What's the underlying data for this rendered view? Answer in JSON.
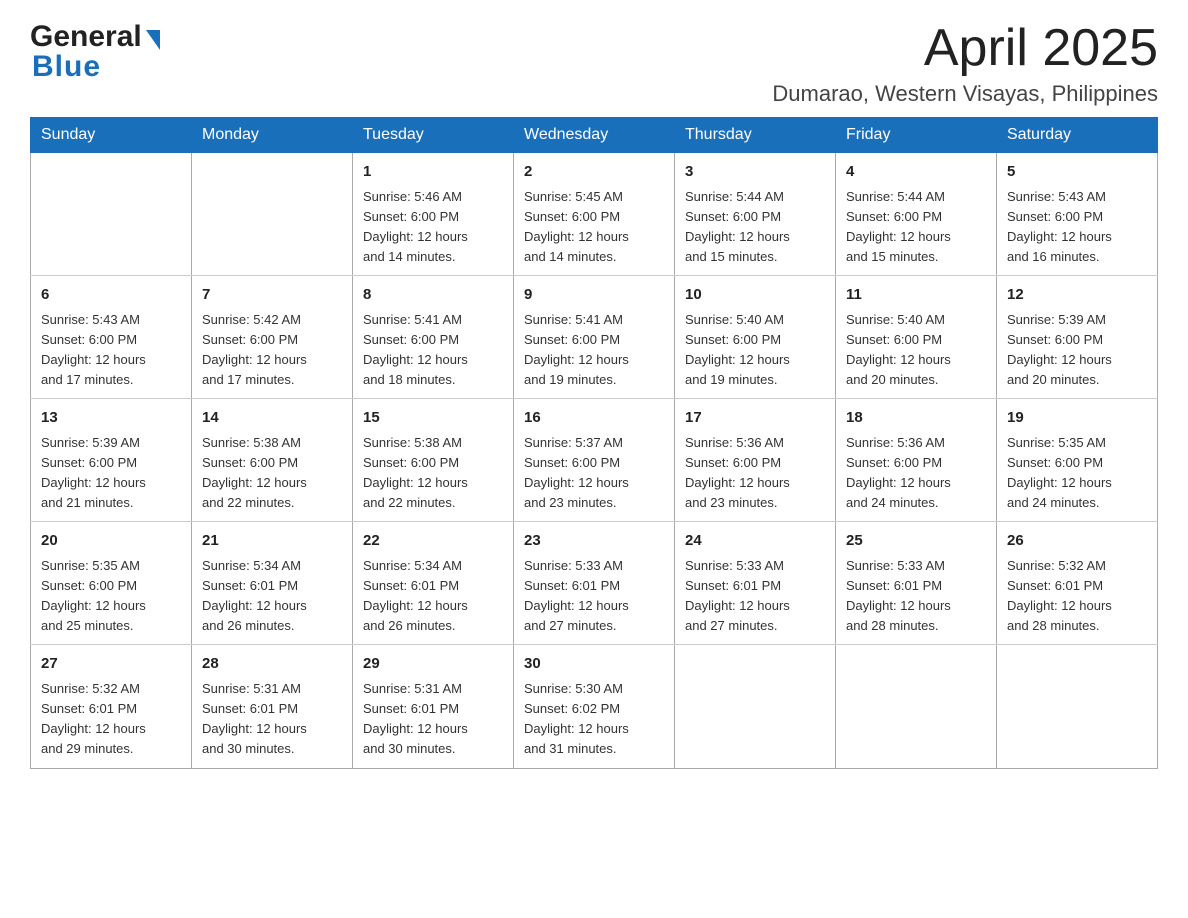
{
  "header": {
    "logo_general": "General",
    "logo_blue": "Blue",
    "month_year": "April 2025",
    "location": "Dumarao, Western Visayas, Philippines"
  },
  "weekdays": [
    "Sunday",
    "Monday",
    "Tuesday",
    "Wednesday",
    "Thursday",
    "Friday",
    "Saturday"
  ],
  "weeks": [
    [
      {
        "day": "",
        "detail": ""
      },
      {
        "day": "",
        "detail": ""
      },
      {
        "day": "1",
        "detail": "Sunrise: 5:46 AM\nSunset: 6:00 PM\nDaylight: 12 hours\nand 14 minutes."
      },
      {
        "day": "2",
        "detail": "Sunrise: 5:45 AM\nSunset: 6:00 PM\nDaylight: 12 hours\nand 14 minutes."
      },
      {
        "day": "3",
        "detail": "Sunrise: 5:44 AM\nSunset: 6:00 PM\nDaylight: 12 hours\nand 15 minutes."
      },
      {
        "day": "4",
        "detail": "Sunrise: 5:44 AM\nSunset: 6:00 PM\nDaylight: 12 hours\nand 15 minutes."
      },
      {
        "day": "5",
        "detail": "Sunrise: 5:43 AM\nSunset: 6:00 PM\nDaylight: 12 hours\nand 16 minutes."
      }
    ],
    [
      {
        "day": "6",
        "detail": "Sunrise: 5:43 AM\nSunset: 6:00 PM\nDaylight: 12 hours\nand 17 minutes."
      },
      {
        "day": "7",
        "detail": "Sunrise: 5:42 AM\nSunset: 6:00 PM\nDaylight: 12 hours\nand 17 minutes."
      },
      {
        "day": "8",
        "detail": "Sunrise: 5:41 AM\nSunset: 6:00 PM\nDaylight: 12 hours\nand 18 minutes."
      },
      {
        "day": "9",
        "detail": "Sunrise: 5:41 AM\nSunset: 6:00 PM\nDaylight: 12 hours\nand 19 minutes."
      },
      {
        "day": "10",
        "detail": "Sunrise: 5:40 AM\nSunset: 6:00 PM\nDaylight: 12 hours\nand 19 minutes."
      },
      {
        "day": "11",
        "detail": "Sunrise: 5:40 AM\nSunset: 6:00 PM\nDaylight: 12 hours\nand 20 minutes."
      },
      {
        "day": "12",
        "detail": "Sunrise: 5:39 AM\nSunset: 6:00 PM\nDaylight: 12 hours\nand 20 minutes."
      }
    ],
    [
      {
        "day": "13",
        "detail": "Sunrise: 5:39 AM\nSunset: 6:00 PM\nDaylight: 12 hours\nand 21 minutes."
      },
      {
        "day": "14",
        "detail": "Sunrise: 5:38 AM\nSunset: 6:00 PM\nDaylight: 12 hours\nand 22 minutes."
      },
      {
        "day": "15",
        "detail": "Sunrise: 5:38 AM\nSunset: 6:00 PM\nDaylight: 12 hours\nand 22 minutes."
      },
      {
        "day": "16",
        "detail": "Sunrise: 5:37 AM\nSunset: 6:00 PM\nDaylight: 12 hours\nand 23 minutes."
      },
      {
        "day": "17",
        "detail": "Sunrise: 5:36 AM\nSunset: 6:00 PM\nDaylight: 12 hours\nand 23 minutes."
      },
      {
        "day": "18",
        "detail": "Sunrise: 5:36 AM\nSunset: 6:00 PM\nDaylight: 12 hours\nand 24 minutes."
      },
      {
        "day": "19",
        "detail": "Sunrise: 5:35 AM\nSunset: 6:00 PM\nDaylight: 12 hours\nand 24 minutes."
      }
    ],
    [
      {
        "day": "20",
        "detail": "Sunrise: 5:35 AM\nSunset: 6:00 PM\nDaylight: 12 hours\nand 25 minutes."
      },
      {
        "day": "21",
        "detail": "Sunrise: 5:34 AM\nSunset: 6:01 PM\nDaylight: 12 hours\nand 26 minutes."
      },
      {
        "day": "22",
        "detail": "Sunrise: 5:34 AM\nSunset: 6:01 PM\nDaylight: 12 hours\nand 26 minutes."
      },
      {
        "day": "23",
        "detail": "Sunrise: 5:33 AM\nSunset: 6:01 PM\nDaylight: 12 hours\nand 27 minutes."
      },
      {
        "day": "24",
        "detail": "Sunrise: 5:33 AM\nSunset: 6:01 PM\nDaylight: 12 hours\nand 27 minutes."
      },
      {
        "day": "25",
        "detail": "Sunrise: 5:33 AM\nSunset: 6:01 PM\nDaylight: 12 hours\nand 28 minutes."
      },
      {
        "day": "26",
        "detail": "Sunrise: 5:32 AM\nSunset: 6:01 PM\nDaylight: 12 hours\nand 28 minutes."
      }
    ],
    [
      {
        "day": "27",
        "detail": "Sunrise: 5:32 AM\nSunset: 6:01 PM\nDaylight: 12 hours\nand 29 minutes."
      },
      {
        "day": "28",
        "detail": "Sunrise: 5:31 AM\nSunset: 6:01 PM\nDaylight: 12 hours\nand 30 minutes."
      },
      {
        "day": "29",
        "detail": "Sunrise: 5:31 AM\nSunset: 6:01 PM\nDaylight: 12 hours\nand 30 minutes."
      },
      {
        "day": "30",
        "detail": "Sunrise: 5:30 AM\nSunset: 6:02 PM\nDaylight: 12 hours\nand 31 minutes."
      },
      {
        "day": "",
        "detail": ""
      },
      {
        "day": "",
        "detail": ""
      },
      {
        "day": "",
        "detail": ""
      }
    ]
  ]
}
